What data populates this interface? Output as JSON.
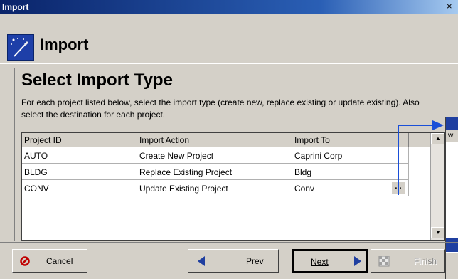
{
  "window": {
    "title": "Import",
    "close_glyph": "×"
  },
  "header": {
    "icon": "magic-wand-icon",
    "title": "Import"
  },
  "step": {
    "title": "Select Import Type",
    "description": "For each project listed below, select the import type (create new, replace existing or update existing). Also select the destination for each project."
  },
  "table": {
    "columns": [
      "Project ID",
      "Import Action",
      "Import To"
    ],
    "rows": [
      [
        "AUTO",
        "Create New Project",
        "Caprini Corp"
      ],
      [
        "BLDG",
        "Replace Existing Project",
        "Bldg"
      ],
      [
        "CONV",
        "Update Existing Project",
        "Conv"
      ]
    ],
    "ellipsis_label": "...",
    "scroll_up": "▲",
    "scroll_down": "▼"
  },
  "buttons": {
    "cancel": "Cancel",
    "prev": "Prev",
    "next": "Next",
    "finish": "Finish"
  },
  "overlay": {
    "partial_text": "w"
  },
  "colors": {
    "accent": "#1f3fa0",
    "callout": "#1a4fd8",
    "cancel_icon": "#c00000"
  }
}
